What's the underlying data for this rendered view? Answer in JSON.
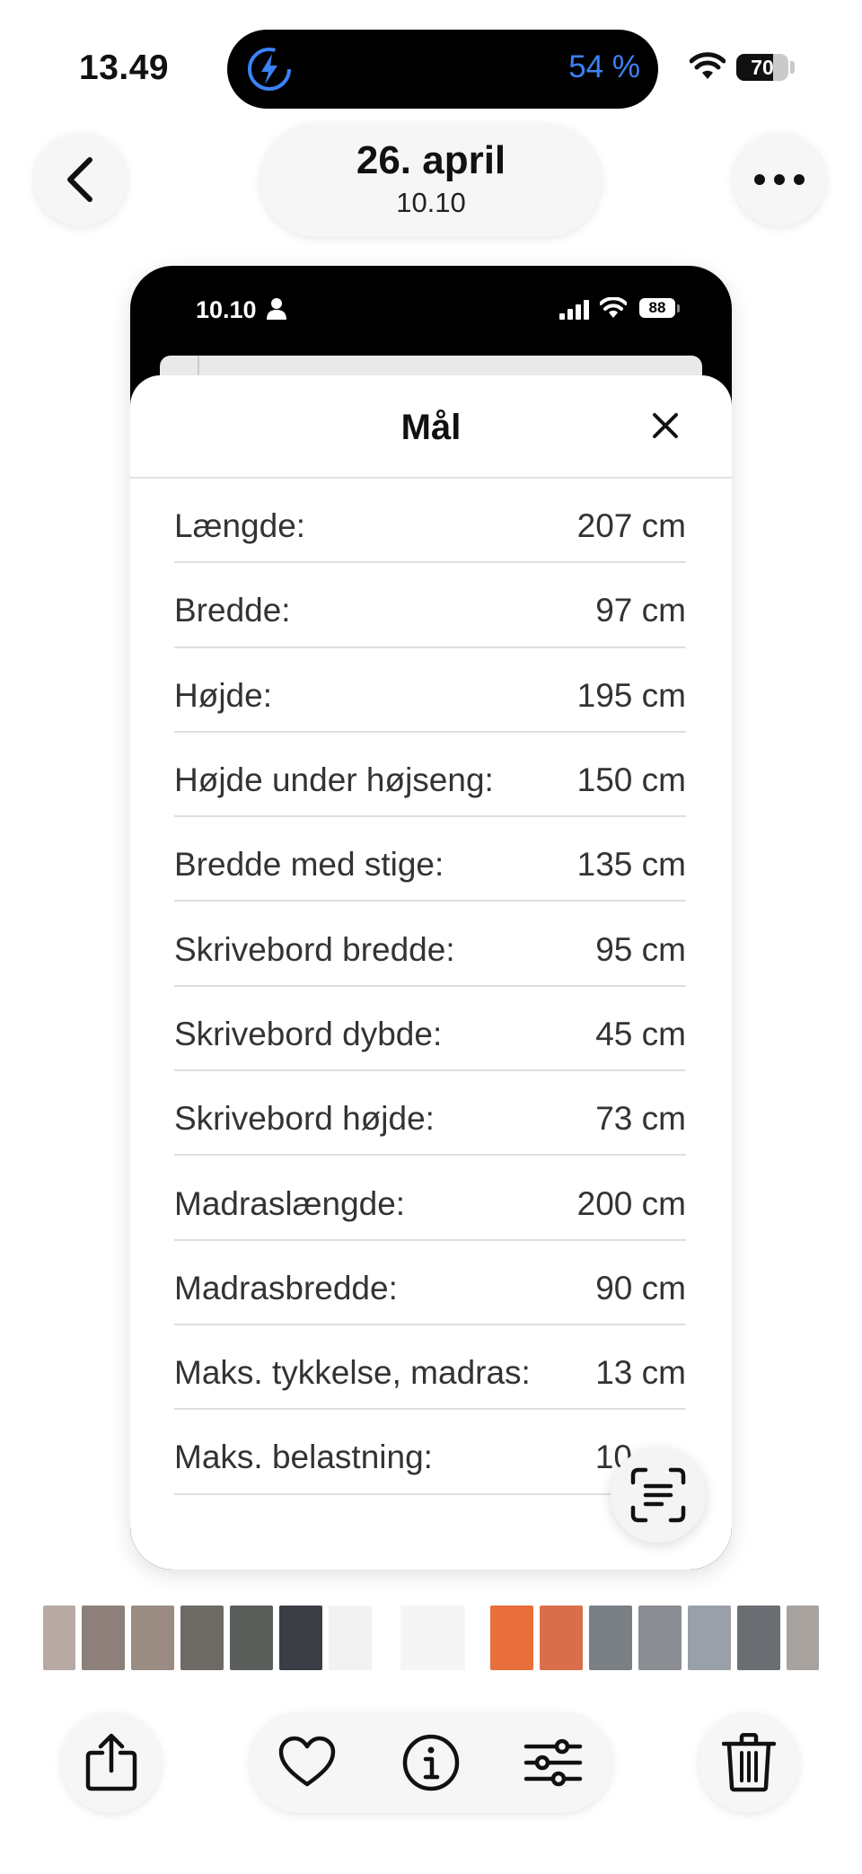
{
  "status_bar": {
    "time": "13.49",
    "island_battery": "54 %",
    "battery_level": "70",
    "battery_fraction": 0.7
  },
  "photo_header": {
    "date": "26. april",
    "time": "10.10"
  },
  "captured_screen": {
    "status_time": "10.10",
    "battery": "88",
    "sheet": {
      "title": "Mål",
      "rows": [
        {
          "label": "Længde:",
          "value": "207 cm"
        },
        {
          "label": "Bredde:",
          "value": "97 cm"
        },
        {
          "label": "Højde:",
          "value": "195 cm"
        },
        {
          "label": "Højde under højseng:",
          "value": "150 cm"
        },
        {
          "label": "Bredde med stige:",
          "value": "135 cm"
        },
        {
          "label": "Skrivebord bredde:",
          "value": "95 cm"
        },
        {
          "label": "Skrivebord dybde:",
          "value": "45 cm"
        },
        {
          "label": "Skrivebord højde:",
          "value": "73 cm"
        },
        {
          "label": "Madraslængde:",
          "value": "200 cm"
        },
        {
          "label": "Madrasbredde:",
          "value": "90 cm"
        },
        {
          "label": "Maks. tykkelse, madras:",
          "value": "13 cm"
        },
        {
          "label": "Maks. belastning:",
          "value": "10"
        }
      ]
    }
  },
  "icons": {
    "back": "chevron-left-icon",
    "more": "ellipsis-icon",
    "charging": "charging-bolt-icon",
    "live_text": "live-text-icon",
    "share": "share-icon",
    "favorite": "heart-icon",
    "info": "info-icon",
    "adjust": "adjust-sliders-icon",
    "delete": "trash-icon"
  },
  "colors": {
    "accent_blue": "#3b82f6",
    "background": "#ffffff",
    "button_bg": "#f6f6f6"
  },
  "thumbnails": [
    "#b7a9a4",
    "#8d7f7a",
    "#9a8c82",
    "#6e6a66",
    "#5a5f5c",
    "#3b3f45",
    "#f2f2f2",
    "#f5f5f5",
    "#e86f3c",
    "#d96f4a",
    "#7a7f84",
    "#8a8e92",
    "#9aa0a7",
    "#6b6f73",
    "#a8a39f"
  ]
}
